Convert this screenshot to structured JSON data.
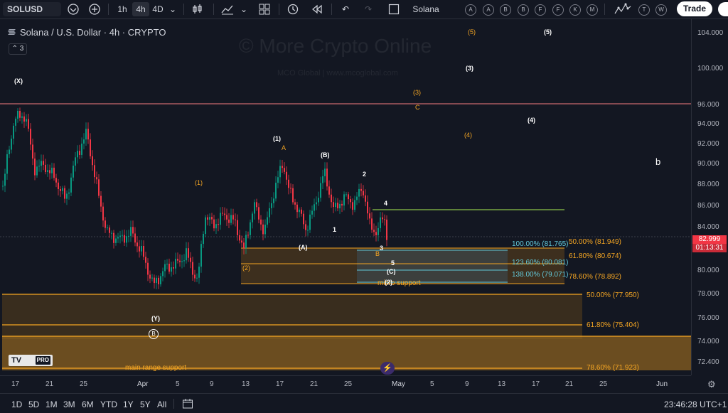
{
  "toolbar": {
    "symbol": "SOLUSD",
    "intervals": [
      "1h",
      "4h",
      "4D"
    ],
    "active_interval": "4h",
    "compare_label": "Solana",
    "circle_tools": [
      "A",
      "A",
      "B",
      "B",
      "F",
      "F",
      "K",
      "M",
      "T",
      "W"
    ],
    "trade_label": "Trade",
    "icons": [
      "symbol-search-icon",
      "add-symbol-icon",
      "bar-style-icon",
      "indicators-icon",
      "chevron-down-icon",
      "layouts-icon",
      "alert-icon",
      "replay-icon",
      "undo-icon",
      "redo-icon",
      "square-icon",
      "elliott-wave-icon"
    ]
  },
  "legend": {
    "title": "Solana / U.S. Dollar · 4h · CRYPTO",
    "layers_count": "3"
  },
  "watermark": {
    "main": "© More Crypto Online",
    "sub": "MCO Global  |  www.mcoglobal.com"
  },
  "price_axis": {
    "ticks": [
      "104.000",
      "100.000",
      "96.000",
      "94.000",
      "92.000",
      "90.000",
      "88.000",
      "86.000",
      "84.000",
      "82.000",
      "80.000",
      "78.000",
      "76.000",
      "74.000",
      "72.400"
    ],
    "last_price": "82.999",
    "countdown": "01:13:31"
  },
  "time_axis": {
    "ticks": [
      "17",
      "21",
      "25",
      "Apr",
      "5",
      "9",
      "13",
      "17",
      "21",
      "25",
      "May",
      "5",
      "9",
      "13",
      "17",
      "21",
      "25",
      "Jun"
    ]
  },
  "fib_labels": {
    "f100": "100.00% (81.765)",
    "f1236": "123.60% (80.081)",
    "f138": "138.00% (79.071)",
    "r50a": "50.00% (81.949)",
    "r618a": "61.80% (80.674)",
    "r786a": "78.60% (78.892)",
    "r50b": "50.00% (77.950)",
    "r618b": "61.80% (75.404)",
    "r786b": "78.60% (71.923)"
  },
  "zone_labels": {
    "micro": "micro support",
    "main": "main range support"
  },
  "wave_labels": {
    "X": "(X)",
    "Y": "(Y)",
    "B_circle": "B",
    "one_orange": "(1)",
    "one_white": "(1)",
    "A_orange": "A",
    "B_paren": "(B)",
    "A_paren": "(A)",
    "two_orange": "(2)",
    "one": "1",
    "two": "2",
    "three": "3",
    "four": "4",
    "five": "5",
    "B_orange": "B",
    "C_paren": "(C)",
    "two_paren": "(2)",
    "three_orange": "(3)",
    "C_orange": "C",
    "four_orange": "(4)",
    "five_orange": "(5)",
    "three_white": "(3)",
    "four_white": "(4)",
    "five_white": "(5)",
    "b": "b"
  },
  "tv_logo": {
    "mark": "TV",
    "pro": "PRO"
  },
  "bottom_bar": {
    "ranges": [
      "1D",
      "5D",
      "1M",
      "3M",
      "6M",
      "YTD",
      "1Y",
      "5Y",
      "All"
    ],
    "time": "23:46:28 UTC+1"
  },
  "colors": {
    "background": "#131722",
    "candle_up": "#089981",
    "candle_down": "#f23645",
    "fib_orange": "#f5a623",
    "resistance_line": "#f77c80",
    "green_line": "#8bc34a"
  }
}
